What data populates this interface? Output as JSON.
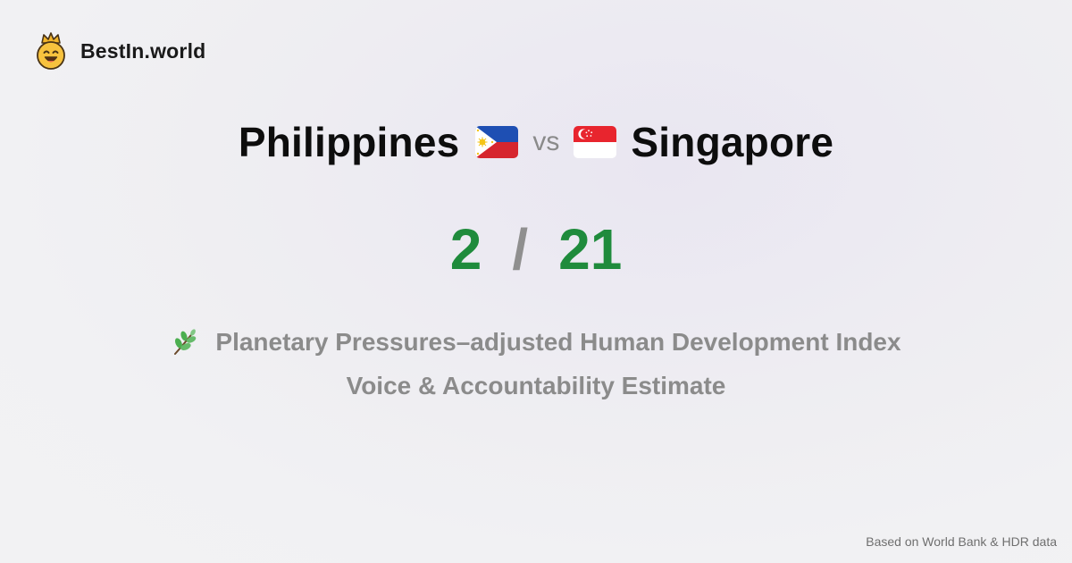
{
  "brand": {
    "name": "BestIn.world",
    "logo_icon": "crowned-smiley-icon"
  },
  "comparison": {
    "left_country": "Philippines",
    "left_flag_icon": "philippines-flag-icon",
    "vs_label": "vs",
    "right_country": "Singapore",
    "right_flag_icon": "singapore-flag-icon"
  },
  "score": {
    "left": "2",
    "separator": "/",
    "right": "21"
  },
  "metric": {
    "icon": "herb-icon",
    "line1": "Planetary Pressures–adjusted Human Development Index",
    "line2": "Voice & Accountability Estimate"
  },
  "footer": {
    "source": "Based on World Bank & HDR data"
  },
  "colors": {
    "score_green": "#1f8b3c",
    "muted_gray": "#8b8b8b"
  }
}
